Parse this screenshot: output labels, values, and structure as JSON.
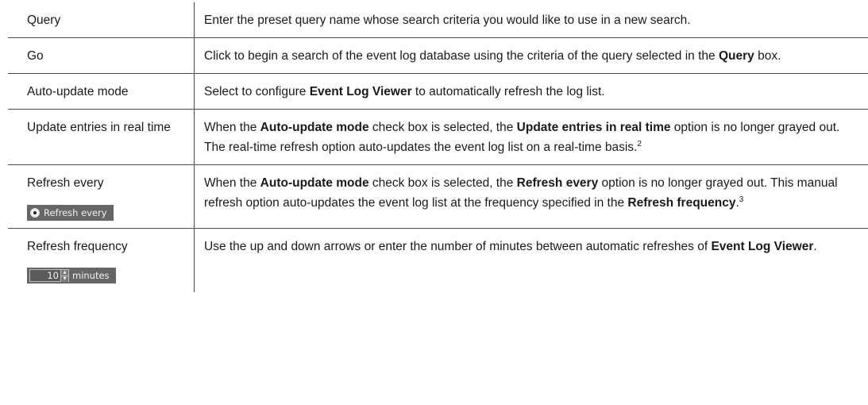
{
  "rows": [
    {
      "term": "Query",
      "desc": [
        {
          "t": "Enter the preset query name whose search criteria you would like to use in a new search."
        }
      ]
    },
    {
      "term": "Go",
      "desc": [
        {
          "t": "Click to begin a search of the event log database using the criteria of the query selected in the "
        },
        {
          "t": "Query",
          "b": true
        },
        {
          "t": " box."
        }
      ]
    },
    {
      "term": "Auto-update mode",
      "desc": [
        {
          "t": "Select to configure "
        },
        {
          "t": "Event Log Viewer",
          "b": true
        },
        {
          "t": " to automatically refresh the log list."
        }
      ]
    },
    {
      "term": "Update entries in real time",
      "desc": [
        {
          "t": "When the "
        },
        {
          "t": "Auto-update mode",
          "b": true
        },
        {
          "t": " check box is selected, the "
        },
        {
          "t": "Update entries in real time",
          "b": true
        },
        {
          "t": " option is no longer grayed out. The real-time refresh option auto-updates the event log list on a real-time basis."
        },
        {
          "t": "2",
          "sup": true
        }
      ]
    },
    {
      "term": "Refresh every",
      "widget": {
        "type": "radio",
        "label": "Refresh every"
      },
      "desc": [
        {
          "t": "When the "
        },
        {
          "t": "Auto-update mode",
          "b": true
        },
        {
          "t": " check box is selected, the "
        },
        {
          "t": "Refresh every",
          "b": true
        },
        {
          "t": " option is no longer grayed out. This manual refresh option auto-updates the event log list at the frequency specified in the "
        },
        {
          "t": "Refresh frequency",
          "b": true
        },
        {
          "t": "."
        },
        {
          "t": "3",
          "sup": true
        }
      ]
    },
    {
      "term": "Refresh frequency",
      "widget": {
        "type": "stepper",
        "value": "10",
        "unit": "minutes"
      },
      "desc": [
        {
          "t": "Use the up and down arrows or enter the number of minutes between automatic refreshes of "
        },
        {
          "t": "Event Log Viewer",
          "b": true
        },
        {
          "t": "."
        }
      ]
    }
  ]
}
